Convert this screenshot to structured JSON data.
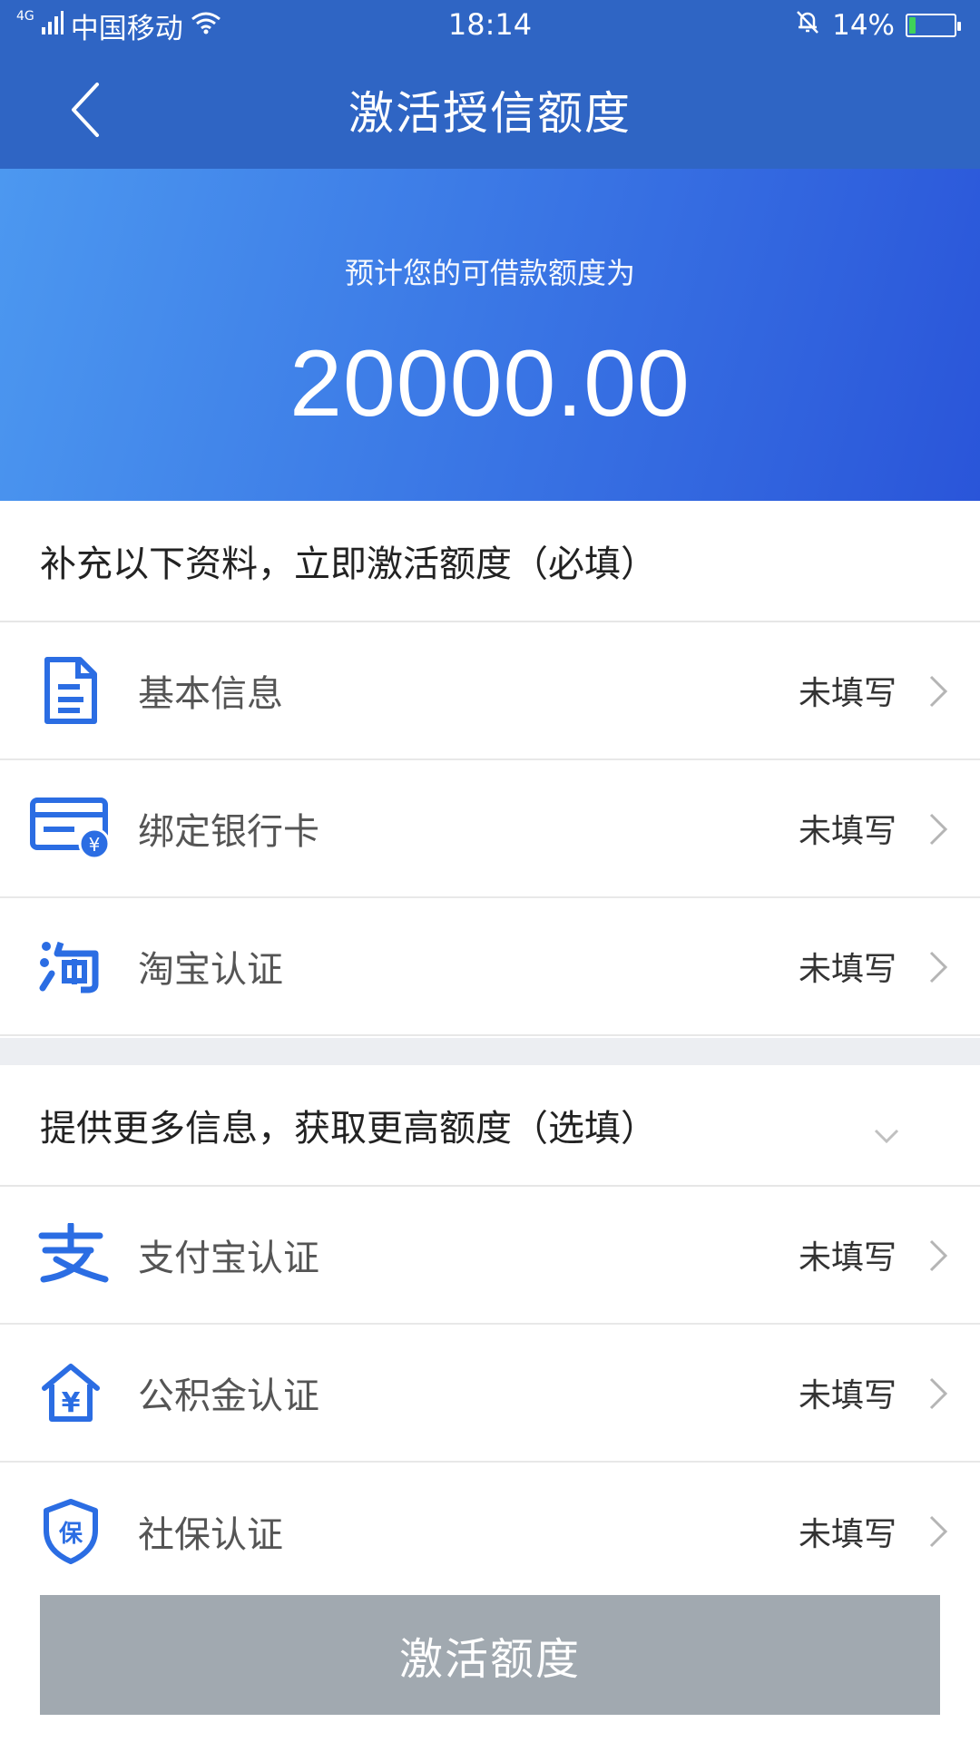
{
  "status_bar": {
    "network": "4G",
    "carrier": "中国移动",
    "time": "18:14",
    "battery": "14%",
    "battery_level": 0.14
  },
  "title_bar": {
    "title": "激活授信额度"
  },
  "hero": {
    "caption": "预计您的可借款额度为",
    "amount": "20000.00"
  },
  "required_section": {
    "title": "补充以下资料，立即激活额度（必填）",
    "items": [
      {
        "label": "基本信息",
        "status": "未填写",
        "icon": "document-icon"
      },
      {
        "label": "绑定银行卡",
        "status": "未填写",
        "icon": "bank-card-icon"
      },
      {
        "label": "淘宝认证",
        "status": "未填写",
        "icon": "taobao-icon"
      }
    ]
  },
  "optional_section": {
    "title": "提供更多信息，获取更高额度（选填）",
    "items": [
      {
        "label": "支付宝认证",
        "status": "未填写",
        "icon": "alipay-icon"
      },
      {
        "label": "公积金认证",
        "status": "未填写",
        "icon": "housing-fund-icon"
      },
      {
        "label": "社保认证",
        "status": "未填写",
        "icon": "social-security-icon"
      }
    ]
  },
  "button": {
    "label": "激活额度"
  },
  "colors": {
    "primary": "#2f65c4",
    "icon_blue": "#2b6de3",
    "disabled_button": "#a1a9b0"
  }
}
